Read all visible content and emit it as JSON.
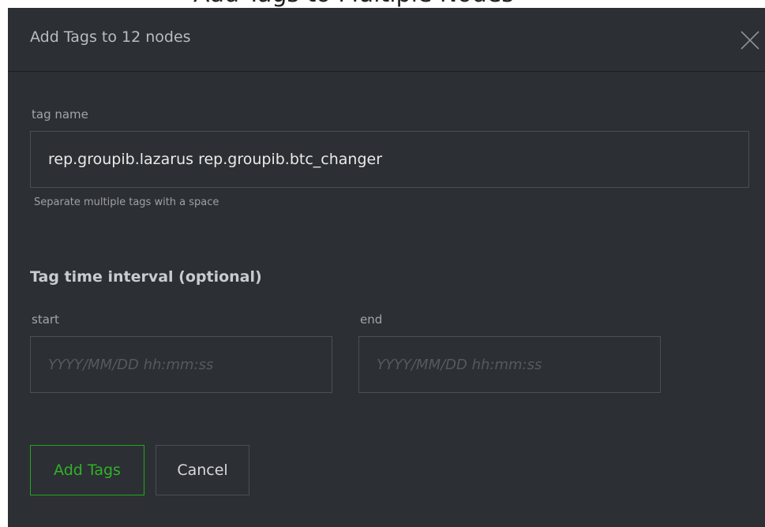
{
  "background": {
    "partial_title": "Add Tags to Multiple Nodes"
  },
  "dialog": {
    "title": "Add Tags to 12 nodes",
    "close_icon": "close-icon",
    "tag_name_label": "tag name",
    "tag_name_value": "rep.groupib.lazarus rep.groupib.btc_changer",
    "tag_help": "Separate multiple tags with a space",
    "interval_heading": "Tag time interval (optional)",
    "start_label": "start",
    "start_placeholder": "YYYY/MM/DD hh:mm:ss",
    "end_label": "end",
    "end_placeholder": "YYYY/MM/DD hh:mm:ss",
    "add_button": "Add Tags",
    "cancel_button": "Cancel"
  },
  "colors": {
    "dialog_bg": "#2c2f33",
    "accent_green": "#2fb22a",
    "border": "#4b4f54"
  }
}
